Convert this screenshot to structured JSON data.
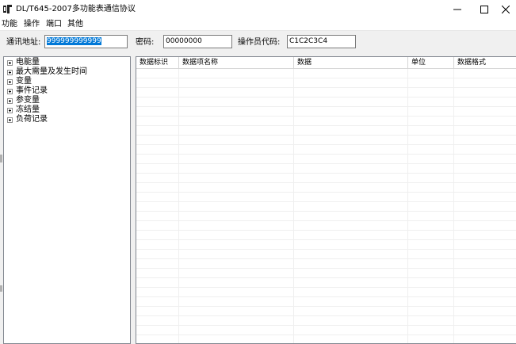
{
  "window": {
    "title": "DL/T645-2007多功能表通信协议",
    "minimize_glyph": "—",
    "close_glyph": "✕"
  },
  "menu": [
    "功能",
    "操作",
    "端口",
    "其他"
  ],
  "toolbar": {
    "address_label": "通讯地址:",
    "address_value": "999999999999",
    "password_label": "密码:",
    "password_value": "00000000",
    "operator_label": "操作员代码:",
    "operator_value": "C1C2C3C4"
  },
  "tree": {
    "items": [
      "电能量",
      "最大需量及发生时间",
      "变量",
      "事件记录",
      "参变量",
      "冻结量",
      "负荷记录"
    ]
  },
  "grid": {
    "columns": [
      "数据标识",
      "数据项名称",
      "数据",
      "单位",
      "数据格式"
    ]
  },
  "colors": {
    "selection": "#0078d7",
    "panel_border": "#828790",
    "window_bg": "#f0f0f0"
  }
}
